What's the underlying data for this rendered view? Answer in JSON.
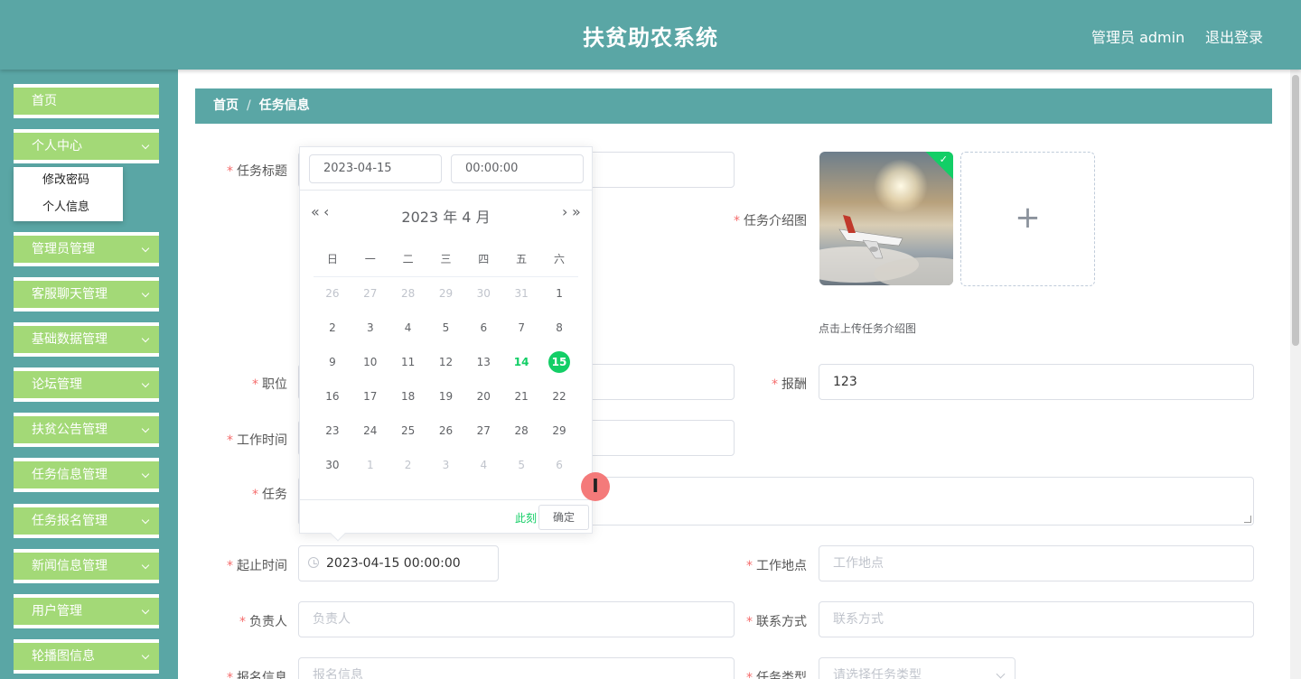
{
  "header": {
    "title": "扶贫助农系统",
    "user": "管理员 admin",
    "logout": "退出登录"
  },
  "sidebar": {
    "items": [
      {
        "label": "首页",
        "chevron": false
      },
      {
        "label": "个人中心",
        "chevron": true
      },
      {
        "label": "管理员管理",
        "chevron": true
      },
      {
        "label": "客服聊天管理",
        "chevron": true
      },
      {
        "label": "基础数据管理",
        "chevron": true
      },
      {
        "label": "论坛管理",
        "chevron": true
      },
      {
        "label": "扶贫公告管理",
        "chevron": true
      },
      {
        "label": "任务信息管理",
        "chevron": true
      },
      {
        "label": "任务报名管理",
        "chevron": true
      },
      {
        "label": "新闻信息管理",
        "chevron": true
      },
      {
        "label": "用户管理",
        "chevron": true
      },
      {
        "label": "轮播图信息",
        "chevron": true
      }
    ],
    "submenu": [
      "修改密码",
      "个人信息"
    ]
  },
  "breadcrumb": {
    "home": "首页",
    "sep": "/",
    "current": "任务信息"
  },
  "form": {
    "required_mark": "*",
    "labels": {
      "title": "任务标题",
      "intro_image": "任务介绍图",
      "position": "职位",
      "pay": "报酬",
      "work_time": "工作时间",
      "task": "任务",
      "start_end": "起止时间",
      "location": "工作地点",
      "owner": "负责人",
      "contact": "联系方式",
      "signup": "报名信息",
      "task_type": "任务类型"
    },
    "values": {
      "pay": "123",
      "start_end": "2023-04-15 00:00:00"
    },
    "placeholders": {
      "location": "工作地点",
      "owner": "负责人",
      "contact": "联系方式",
      "signup": "报名信息",
      "task_type": "请选择任务类型"
    },
    "upload_tip": "点击上传任务介绍图",
    "upload_plus": "+"
  },
  "datepicker": {
    "date_value": "2023-04-15",
    "time_value": "00:00:00",
    "prev_year": "«",
    "prev_month": "‹",
    "next_month": "›",
    "next_year": "»",
    "month_label": "2023 年  4 月",
    "weekdays": [
      "日",
      "一",
      "二",
      "三",
      "四",
      "五",
      "六"
    ],
    "weeks": [
      [
        {
          "d": "26",
          "t": "other"
        },
        {
          "d": "27",
          "t": "other"
        },
        {
          "d": "28",
          "t": "other"
        },
        {
          "d": "29",
          "t": "other"
        },
        {
          "d": "30",
          "t": "other"
        },
        {
          "d": "31",
          "t": "other"
        },
        {
          "d": "1",
          "t": ""
        }
      ],
      [
        {
          "d": "2",
          "t": ""
        },
        {
          "d": "3",
          "t": ""
        },
        {
          "d": "4",
          "t": ""
        },
        {
          "d": "5",
          "t": ""
        },
        {
          "d": "6",
          "t": ""
        },
        {
          "d": "7",
          "t": ""
        },
        {
          "d": "8",
          "t": ""
        }
      ],
      [
        {
          "d": "9",
          "t": ""
        },
        {
          "d": "10",
          "t": ""
        },
        {
          "d": "11",
          "t": ""
        },
        {
          "d": "12",
          "t": ""
        },
        {
          "d": "13",
          "t": ""
        },
        {
          "d": "14",
          "t": "today"
        },
        {
          "d": "15",
          "t": "selected"
        }
      ],
      [
        {
          "d": "16",
          "t": ""
        },
        {
          "d": "17",
          "t": ""
        },
        {
          "d": "18",
          "t": ""
        },
        {
          "d": "19",
          "t": ""
        },
        {
          "d": "20",
          "t": ""
        },
        {
          "d": "21",
          "t": ""
        },
        {
          "d": "22",
          "t": ""
        }
      ],
      [
        {
          "d": "23",
          "t": ""
        },
        {
          "d": "24",
          "t": ""
        },
        {
          "d": "25",
          "t": ""
        },
        {
          "d": "26",
          "t": ""
        },
        {
          "d": "27",
          "t": ""
        },
        {
          "d": "28",
          "t": ""
        },
        {
          "d": "29",
          "t": ""
        }
      ],
      [
        {
          "d": "30",
          "t": ""
        },
        {
          "d": "1",
          "t": "other"
        },
        {
          "d": "2",
          "t": "other"
        },
        {
          "d": "3",
          "t": "other"
        },
        {
          "d": "4",
          "t": "other"
        },
        {
          "d": "5",
          "t": "other"
        },
        {
          "d": "6",
          "t": "other"
        }
      ]
    ],
    "now_label": "此刻",
    "ok_label": "确定"
  },
  "cursor": {
    "glyph": "I"
  },
  "colors": {
    "teal": "#5aa6a5",
    "menu_green": "#a3d977",
    "accent": "#13ce66",
    "required": "#f56c6c"
  }
}
